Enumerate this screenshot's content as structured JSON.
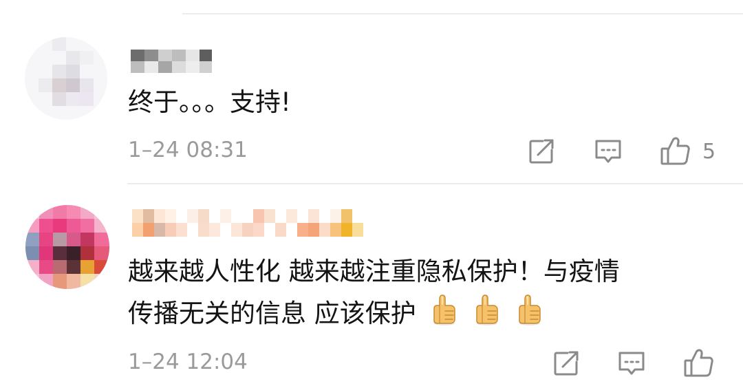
{
  "comments": [
    {
      "username_display": "",
      "text": "终于。。。支持!",
      "time": "1–24 08:31",
      "like_count": "5",
      "icons": {
        "share": "share-square-arrow-icon",
        "reply": "comment-bubble-icon",
        "like": "thumbs-up-outline-icon"
      }
    },
    {
      "username_display": "",
      "text_line1": "越来越人性化 越来越注重隐私保护！与疫情",
      "text_line2": "传播无关的信息 应该保护",
      "emoji_count": 3,
      "emoji": "thumbs-up-emoji",
      "time": "1–24 12:04",
      "like_count": "",
      "icons": {
        "share": "share-square-arrow-icon",
        "reply": "comment-bubble-icon",
        "like": "thumbs-up-outline-icon"
      }
    }
  ],
  "colors": {
    "text": "#141414",
    "meta": "#9a9a9a",
    "icon": "#8a8a8a",
    "divider": "#ececec"
  }
}
